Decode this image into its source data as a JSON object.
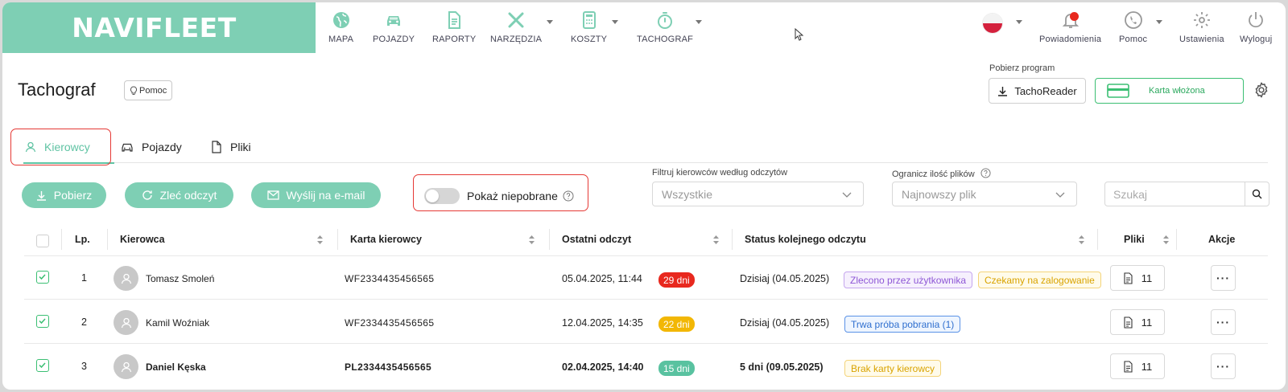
{
  "app": {
    "logo": "NAVIFLEET"
  },
  "topnav": {
    "items": [
      {
        "label": "MAPA",
        "icon": "globe-icon"
      },
      {
        "label": "POJAZDY",
        "icon": "car-icon"
      },
      {
        "label": "RAPORTY",
        "icon": "document-icon"
      },
      {
        "label": "NARZĘDZIA",
        "icon": "tools-icon",
        "dropdown": true
      },
      {
        "label": "KOSZTY",
        "icon": "calculator-icon",
        "dropdown": true
      },
      {
        "label": "TACHOGRAF",
        "icon": "stopwatch-icon",
        "dropdown": true
      }
    ],
    "right": [
      {
        "label": "Powiadomienia",
        "icon": "bell-icon",
        "has_dot": true
      },
      {
        "label": "Pomoc",
        "icon": "phone-icon",
        "dropdown": true
      },
      {
        "label": "Ustawienia",
        "icon": "gear-icon"
      },
      {
        "label": "Wyloguj",
        "icon": "power-icon"
      }
    ],
    "language": "pl-flag-icon"
  },
  "header": {
    "title": "Tachograf",
    "help_chip": "Pomoc",
    "pobierz_label": "Pobierz program",
    "tachoreader_button": "TachoReader",
    "karta_button": "Karta włożona"
  },
  "tabs": [
    {
      "label": "Kierowcy",
      "active": true
    },
    {
      "label": "Pojazdy",
      "active": false
    },
    {
      "label": "Pliki",
      "active": false
    }
  ],
  "toolbar": {
    "pobierz": "Pobierz",
    "zlec_odczyt": "Zleć odczyt",
    "wyslij_email": "Wyślij na e-mail",
    "toggle_label": "Pokaż niepobrane",
    "toggle_on": false,
    "filter_label": "Filtruj kierowców według odczytów",
    "filter_value": "Wszystkie",
    "limit_label": "Ogranicz ilość plików",
    "limit_value": "Najnowszy plik",
    "search_placeholder": "Szukaj"
  },
  "table": {
    "headers": {
      "lp": "Lp.",
      "kierowca": "Kierowca",
      "karta": "Karta kierowcy",
      "odczyt": "Ostatni odczyt",
      "status": "Status kolejnego odczytu",
      "pliki": "Pliki",
      "akcje": "Akcje"
    },
    "rows": [
      {
        "checked": true,
        "lp": "1",
        "name": "Tomasz Smoleń",
        "card": "WF2334435456565",
        "last_read": "05.04.2025, 11:44",
        "days": "29 dni",
        "days_color": "#e8281e",
        "next": "Dzisiaj (04.05.2025)",
        "tags": [
          {
            "text": "Zlecono przez użytkownika",
            "color": "#8e57d6",
            "bg": "#f6f0fd",
            "border": "#c5a6ee"
          },
          {
            "text": "Czekamy na zalogowanie",
            "color": "#d9a300",
            "bg": "#fffbea",
            "border": "#f4d47a"
          }
        ],
        "files": "11",
        "bold": false
      },
      {
        "checked": true,
        "lp": "2",
        "name": "Kamil Woźniak",
        "card": "WF2334435456565",
        "last_read": "12.04.2025, 14:35",
        "days": "22 dni",
        "days_color": "#f2b705",
        "next": "Dzisiaj (04.05.2025)",
        "tags": [
          {
            "text": "Trwa próba pobrania (1)",
            "color": "#2f6fcf",
            "bg": "#eef5ff",
            "border": "#5a92e6"
          }
        ],
        "files": "11",
        "bold": false
      },
      {
        "checked": true,
        "lp": "3",
        "name": "Daniel Kęska",
        "card": "PL2334435456565",
        "last_read": "02.04.2025, 14:40",
        "days": "15 dni",
        "days_color": "#59c2a0",
        "next": "5 dni (09.05.2025)",
        "tags": [
          {
            "text": "Brak karty kierowcy",
            "color": "#d9a300",
            "bg": "#fffbea",
            "border": "#f4d47a"
          }
        ],
        "files": "11",
        "bold": true
      }
    ]
  },
  "colors": {
    "brand": "#7ecfb4",
    "accent": "#5fc3a3",
    "highlight": "#e53935"
  }
}
